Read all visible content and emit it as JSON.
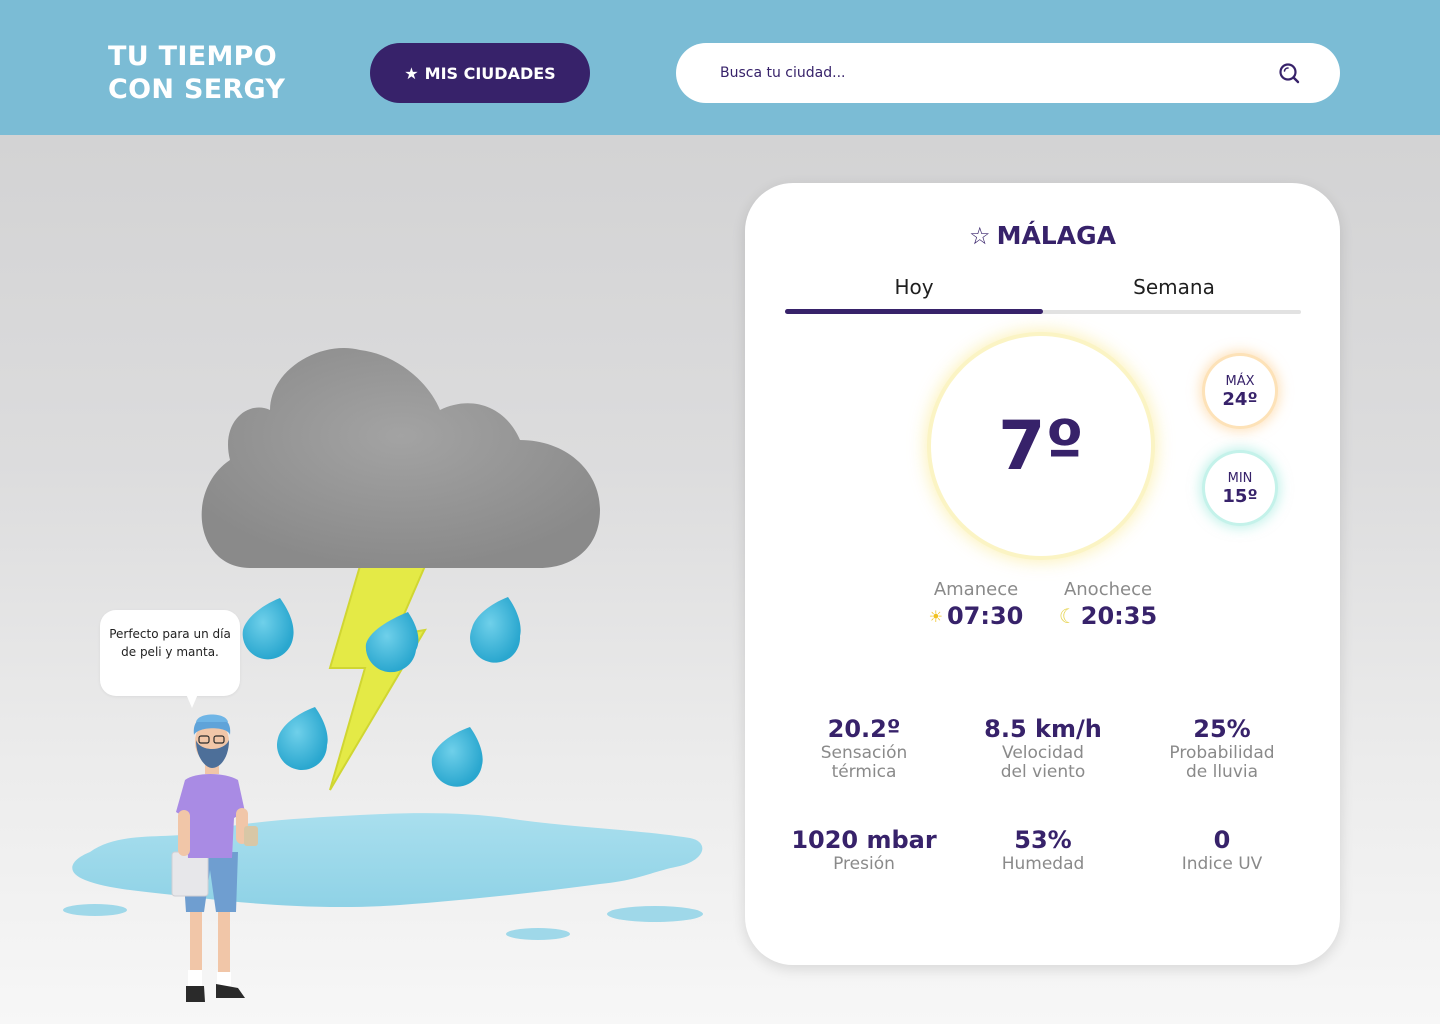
{
  "header": {
    "brand_line1": "TU TIEMPO",
    "brand_line2": "CON SERGY",
    "cities_button": "MIS CIUDADES",
    "search_placeholder": "Busca tu ciudad...",
    "bg_color": "#7bbcd5",
    "accent_color": "#37226a"
  },
  "illustration": {
    "speech_bubble": "Perfecto para un día de peli y manta.",
    "icons": [
      "storm-cloud",
      "lightning-bolt",
      "rain-drops",
      "puddle",
      "person-character"
    ]
  },
  "weather": {
    "city": "MÁLAGA",
    "tabs": [
      {
        "label": "Hoy",
        "active": true
      },
      {
        "label": "Semana",
        "active": false
      }
    ],
    "current_temp": "7º",
    "max": {
      "label": "MÁX",
      "value": "24º"
    },
    "min": {
      "label": "MIN",
      "value": "15º"
    },
    "sunrise": {
      "label": "Amanece",
      "time": "07:30"
    },
    "sunset": {
      "label": "Anochece",
      "time": "20:35"
    },
    "stats": [
      {
        "value": "20.2º",
        "label_line1": "Sensación",
        "label_line2": "térmica"
      },
      {
        "value": "8.5 km/h",
        "label_line1": "Velocidad",
        "label_line2": "del viento"
      },
      {
        "value": "25%",
        "label_line1": "Probabilidad",
        "label_line2": "de lluvia"
      },
      {
        "value": "1020 mbar",
        "label_line1": "Presión",
        "label_line2": ""
      },
      {
        "value": "53%",
        "label_line1": "Humedad",
        "label_line2": ""
      },
      {
        "value": "0",
        "label_line1": "Indice UV",
        "label_line2": ""
      }
    ]
  }
}
